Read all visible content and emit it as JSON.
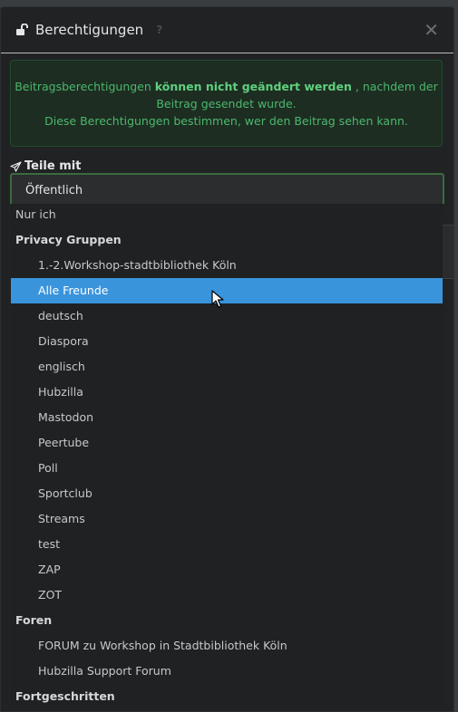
{
  "modal": {
    "title": "Berechtigungen",
    "help": "?",
    "close": "✕"
  },
  "alert": {
    "text1": "Beitragsberechtigungen",
    "bold": "können nicht geändert werden",
    "text2": ", nachdem der",
    "line2": "Beitrag gesendet wurde.",
    "line3": "Diese Berechtigungen bestimmen, wer den Beitrag sehen kann."
  },
  "share": {
    "label": "Teile mit",
    "selected": "Öffentlich"
  },
  "dropdown": {
    "top_item": "Nur ich",
    "group1": "Privacy Gruppen",
    "items1": [
      "1.-2.Workshop-stadtbibliothek Köln",
      "Alle Freunde",
      "deutsch",
      "Diaspora",
      "englisch",
      "Hubzilla",
      "Mastodon",
      "Peertube",
      "Poll",
      "Sportclub",
      "Streams",
      "test",
      "ZAP",
      "ZOT"
    ],
    "group2": "Foren",
    "items2": [
      "FORUM zu Workshop in Stadtbibliothek Köln",
      "Hubzilla Support Forum"
    ],
    "group3": "Fortgeschritten",
    "highlighted": "Alle Freunde"
  },
  "colors": {
    "highlight": "#3a94dc",
    "alert_text": "#4cb86c",
    "background": "#202224"
  }
}
